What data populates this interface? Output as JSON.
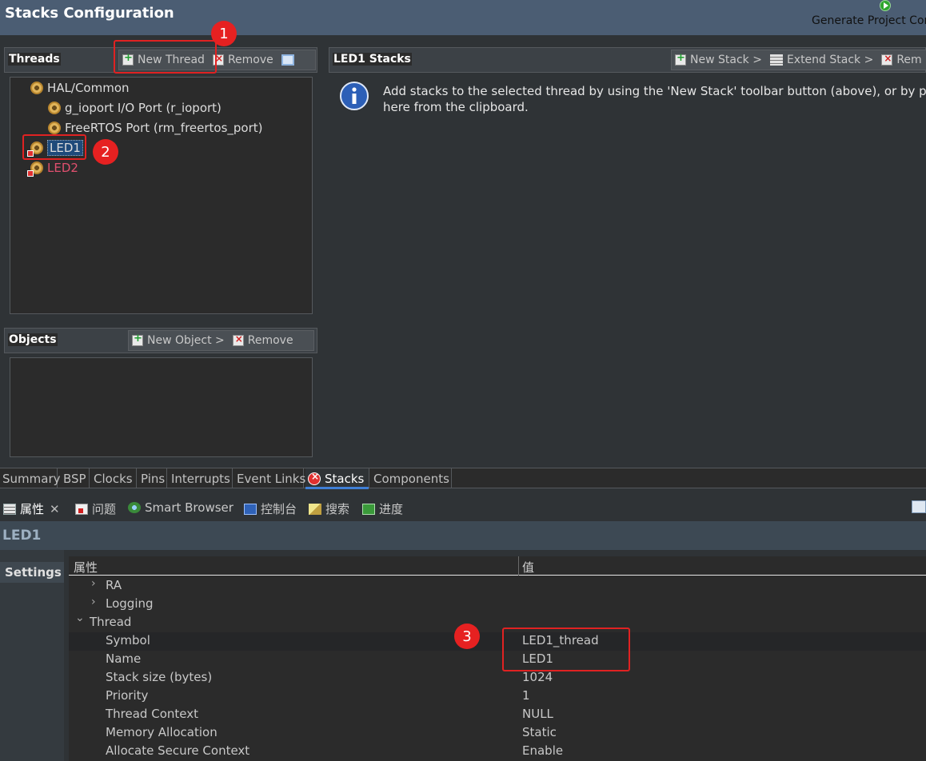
{
  "window": {
    "title": "Stacks Configuration",
    "generate_label": "Generate Project Content"
  },
  "threads_panel": {
    "title": "Threads",
    "new_thread": "New Thread",
    "remove": "Remove",
    "items": [
      {
        "label": "HAL/Common",
        "level": 0,
        "icon": "gear-icon"
      },
      {
        "label": "g_ioport I/O Port (r_ioport)",
        "level": 1,
        "icon": "gear-icon"
      },
      {
        "label": "FreeRTOS Port (rm_freertos_port)",
        "level": 1,
        "icon": "gear-icon"
      },
      {
        "label": "LED1",
        "level": 0,
        "icon": "gear-error-icon",
        "selected": true
      },
      {
        "label": "LED2",
        "level": 0,
        "icon": "gear-error-icon",
        "error": true
      }
    ]
  },
  "objects_panel": {
    "title": "Objects",
    "new_object": "New Object >",
    "remove": "Remove"
  },
  "stacks_panel": {
    "title": "LED1 Stacks",
    "new_stack": "New Stack >",
    "extend_stack": "Extend Stack >",
    "remove_partial": "Rem",
    "info_line1": "Add stacks to the selected thread by using the 'New Stack' toolbar button (above), or by pasting",
    "info_line2": "here from the clipboard."
  },
  "editor_tabs": [
    "Summary",
    "BSP",
    "Clocks",
    "Pins",
    "Interrupts",
    "Event Links",
    "Stacks",
    "Components"
  ],
  "active_editor_tab": "Stacks",
  "view_tabs": [
    "属性",
    "问题",
    "Smart Browser",
    "控制台",
    "搜索",
    "进度"
  ],
  "active_view_tab": "属性",
  "selected_object": "LED1",
  "settings_tab": "Settings",
  "properties": {
    "col_property": "属性",
    "col_value": "值",
    "rows": [
      {
        "key": "RA",
        "value": "",
        "level": 1,
        "expandable": true,
        "expanded": false
      },
      {
        "key": "Logging",
        "value": "",
        "level": 1,
        "expandable": true,
        "expanded": false
      },
      {
        "key": "Thread",
        "value": "",
        "level": 0,
        "expandable": true,
        "expanded": true
      },
      {
        "key": "Symbol",
        "value": "LED1_thread",
        "level": 2
      },
      {
        "key": "Name",
        "value": "LED1",
        "level": 2
      },
      {
        "key": "Stack size (bytes)",
        "value": "1024",
        "level": 2
      },
      {
        "key": "Priority",
        "value": "1",
        "level": 2
      },
      {
        "key": "Thread Context",
        "value": "NULL",
        "level": 2
      },
      {
        "key": "Memory Allocation",
        "value": "Static",
        "level": 2
      },
      {
        "key": "Allocate Secure Context",
        "value": "Enable",
        "level": 2
      }
    ]
  },
  "annotations": [
    "1",
    "2",
    "3"
  ],
  "colors": {
    "annotation_red": "#e02222",
    "header_bg": "#4b5d73",
    "error_text": "#e0506e",
    "active_tab_underline": "#3f7fd6"
  }
}
